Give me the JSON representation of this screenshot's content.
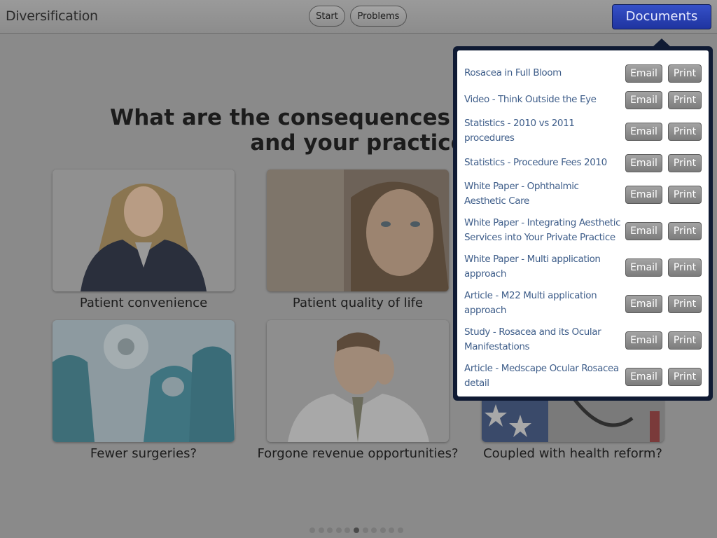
{
  "header": {
    "app_title": "Diversification",
    "nav": [
      {
        "label": "Start"
      },
      {
        "label": "Problems"
      }
    ],
    "documents_label": "Documents"
  },
  "slide": {
    "headline_line1": "What are the consequences of Ros",
    "headline_line2": "and your practice?",
    "cards": [
      {
        "caption": "Patient convenience"
      },
      {
        "caption": "Patient quality of life"
      },
      {
        "caption": "Fewer surgeries?"
      },
      {
        "caption": "Forgone revenue opportunities?"
      },
      {
        "caption": "Coupled with health reform?"
      }
    ],
    "page_count": 11,
    "active_page": 5
  },
  "documents": {
    "email_label": "Email",
    "print_label": "Print",
    "items": [
      {
        "title": "Rosacea in Full Bloom"
      },
      {
        "title": "Video - Think Outside the Eye"
      },
      {
        "title": "Statistics - 2010 vs 2011 procedures"
      },
      {
        "title": "Statistics - Procedure Fees 2010"
      },
      {
        "title": "White Paper - Ophthalmic Aesthetic Care"
      },
      {
        "title": "White Paper - Integrating Aesthetic Services into Your Private Practice"
      },
      {
        "title": "White Paper - Multi application approach"
      },
      {
        "title": "Article - M22 Multi application approach"
      },
      {
        "title": "Study - Rosacea and its Ocular Manifestations"
      },
      {
        "title": "Article - Medscape Ocular Rosacea detail"
      }
    ]
  },
  "colors": {
    "overlay_gray": "#8a8a8a",
    "documents_button": "#2a42b8",
    "popover_border": "#0f1a33",
    "link_text": "#3f5e8a"
  }
}
